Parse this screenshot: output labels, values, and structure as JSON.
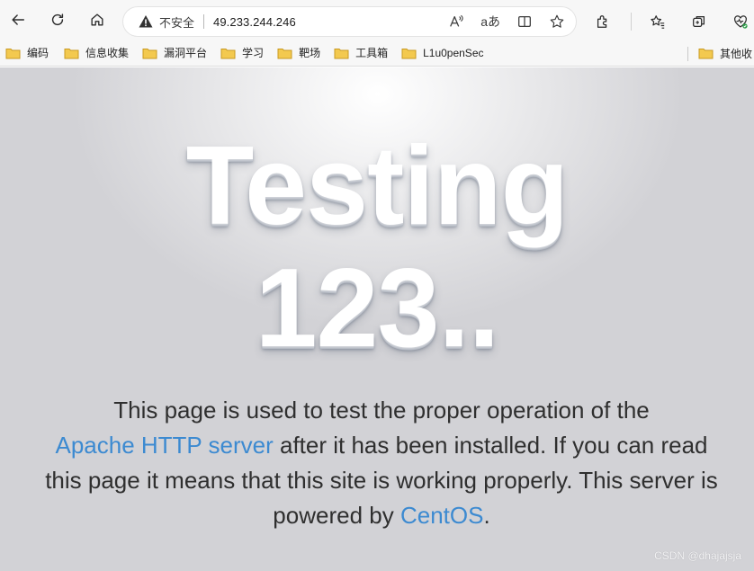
{
  "toolbar": {
    "security_warning": "不安全",
    "url": "49.233.244.246",
    "read_aloud_label": "A⁾",
    "translate_label": "aあ"
  },
  "bookmarks": [
    {
      "label": "编码"
    },
    {
      "label": "信息收集"
    },
    {
      "label": "漏洞平台"
    },
    {
      "label": "学习"
    },
    {
      "label": "靶场"
    },
    {
      "label": "工具箱"
    },
    {
      "label": "L1u0penSec"
    }
  ],
  "bookmarks_right": {
    "label": "其他收"
  },
  "page": {
    "heading_line1": "Testing",
    "heading_line2": "123..",
    "text_1": "This page is used to test the proper operation of the",
    "link_apache": "Apache HTTP server",
    "text_2": " after it has been installed. If you can read this page it means that this site is working properly. This server is powered by ",
    "link_centos": "CentOS",
    "text_3": "."
  },
  "watermark": "CSDN @dhajajsja",
  "colors": {
    "link": "#3c8ad1",
    "folder": "#f3c94f",
    "warning": "#333333"
  }
}
